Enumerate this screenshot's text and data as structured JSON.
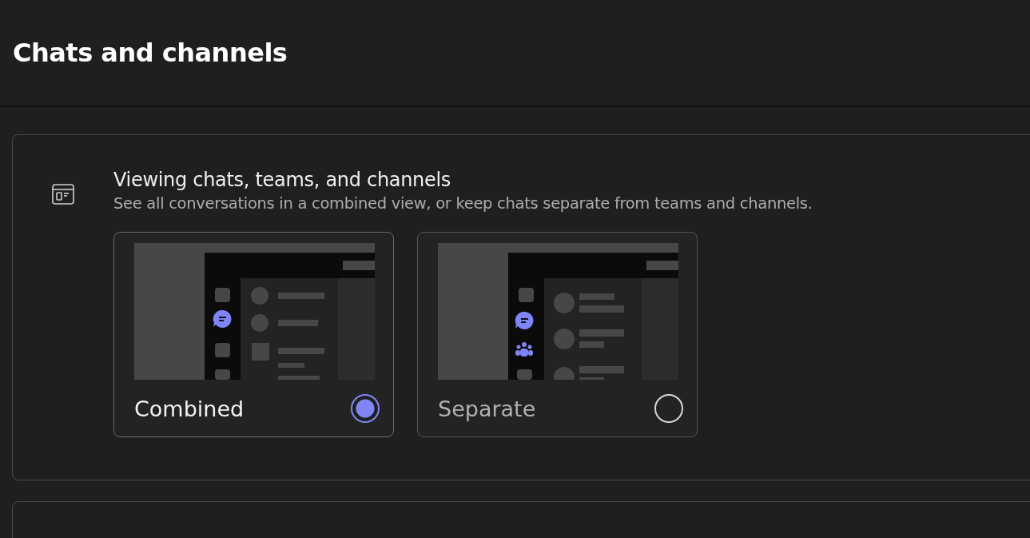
{
  "header": {
    "title": "Chats and channels"
  },
  "section": {
    "title": "Viewing chats, teams, and channels",
    "description": "See all conversations in a combined view, or keep chats separate from teams and channels.",
    "options": [
      {
        "kind": "combined",
        "label": "Combined",
        "selected": true
      },
      {
        "kind": "separate",
        "label": "Separate",
        "selected": false
      }
    ]
  }
}
